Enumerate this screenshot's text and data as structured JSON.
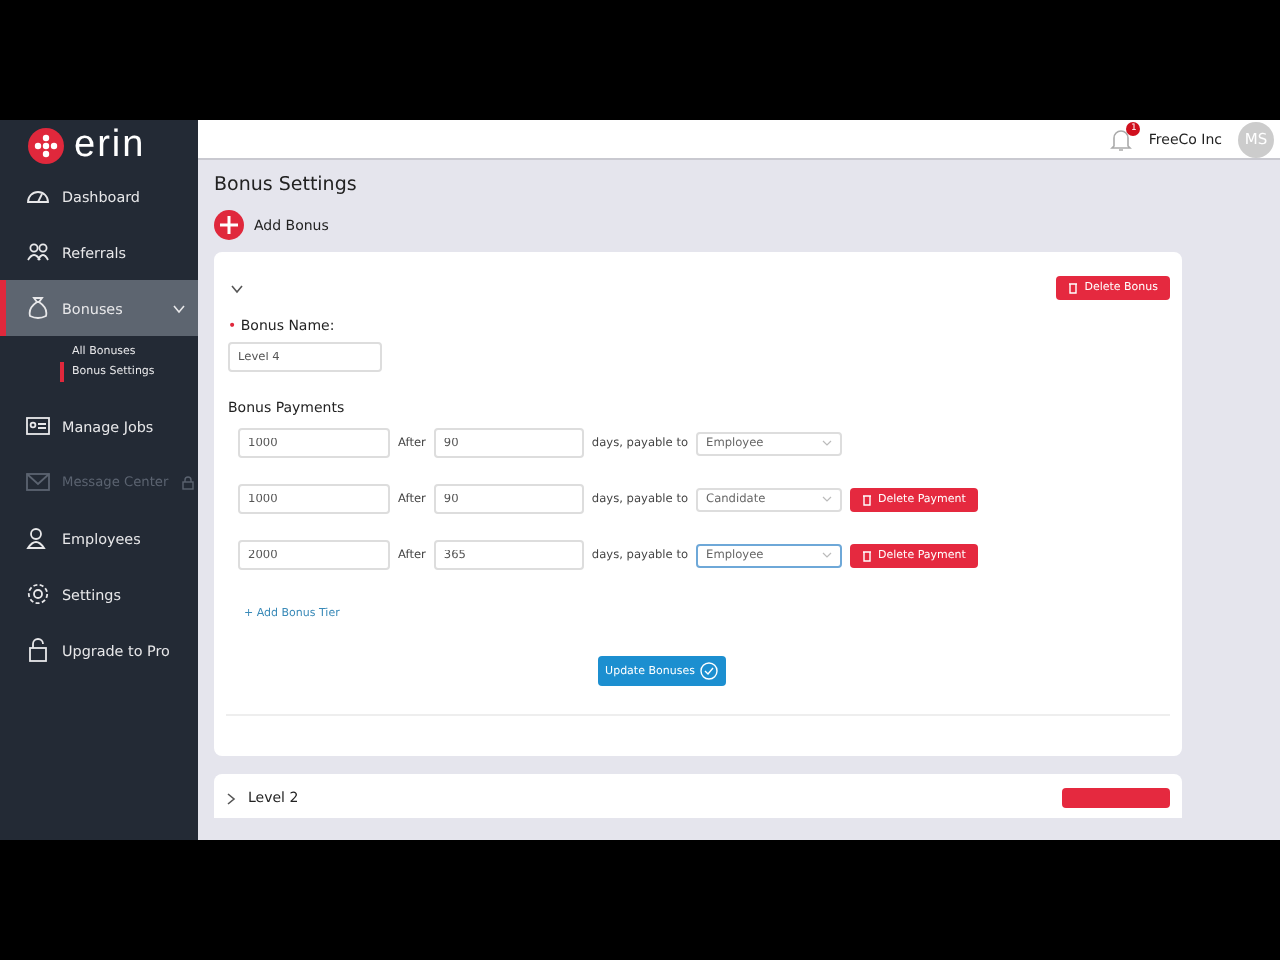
{
  "sidebar": {
    "logo": "erin",
    "items": [
      {
        "label": "Dashboard",
        "kind": "gauge",
        "selected": false,
        "disabled": false
      },
      {
        "label": "Referrals",
        "kind": "people",
        "selected": false,
        "disabled": false
      },
      {
        "label": "Bonuses",
        "kind": "bag",
        "selected": true,
        "disabled": false,
        "expanded": true,
        "children": [
          {
            "label": "All Bonuses",
            "selected": false
          },
          {
            "label": "Bonus Settings",
            "selected": true
          }
        ]
      },
      {
        "label": "Manage Jobs",
        "kind": "card",
        "selected": false,
        "disabled": false
      },
      {
        "label": "Message Center",
        "kind": "mail",
        "selected": false,
        "disabled": true
      },
      {
        "label": "Employees",
        "kind": "person",
        "selected": false,
        "disabled": false
      },
      {
        "label": "Settings",
        "kind": "gear",
        "selected": false,
        "disabled": false
      },
      {
        "label": "Upgrade to Pro",
        "kind": "padlock",
        "selected": false,
        "disabled": false
      }
    ]
  },
  "topbar": {
    "notification_count": "1",
    "company": "FreeCo Inc",
    "avatar": "MS"
  },
  "page": {
    "title": "Bonus Settings",
    "add_label": "Add Bonus"
  },
  "bonus_card": {
    "expanded": true,
    "delete_label": "Delete Bonus",
    "required_mark": "•",
    "name_label": "Bonus Name:",
    "name_value": "Level 4",
    "payments_label": "Bonus Payments",
    "payments": [
      {
        "amount": "1000",
        "after_label": "After",
        "days": "90",
        "payable_label": "days, payable to",
        "payable_to": "Employee",
        "focused": false
      },
      {
        "amount": "1000",
        "after_label": "After",
        "days": "90",
        "payable_label": "days, payable to",
        "payable_to": "Candidate",
        "focused": false,
        "delete_label": "Delete Payment"
      },
      {
        "amount": "2000",
        "after_label": "After",
        "days": "365",
        "payable_label": "days, payable to",
        "payable_to": "Employee",
        "focused": true,
        "delete_label": "Delete Payment"
      }
    ],
    "add_tier_label": "+ Add Bonus Tier",
    "update_label": "Update Bonuses"
  },
  "next_card": {
    "title": "Level 2",
    "expanded": false
  }
}
